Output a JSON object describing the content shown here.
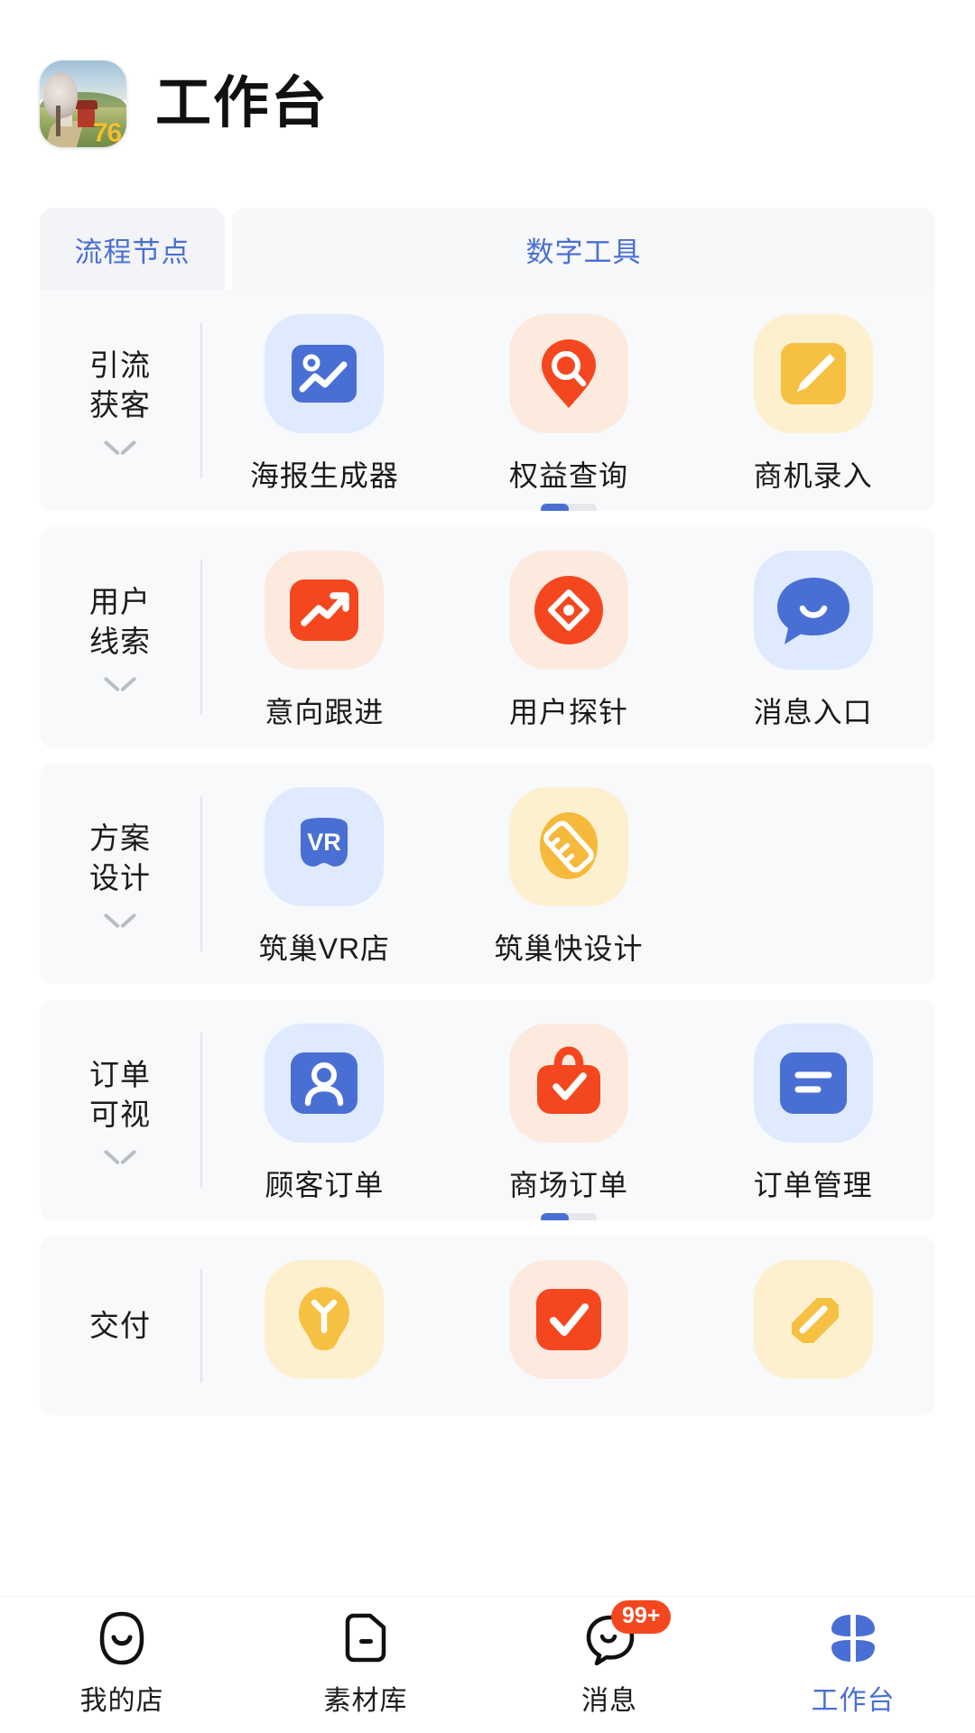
{
  "header": {
    "title": "工作台",
    "app_icon": "farm-landscape-app-icon",
    "icon_badge": "76"
  },
  "tabs": [
    {
      "id": "process-nodes",
      "label": "流程节点",
      "active": true
    },
    {
      "id": "digital-tools",
      "label": "数字工具",
      "active": false
    }
  ],
  "groups": [
    {
      "id": "lead-acquisition",
      "label": "引流\n获客",
      "label_lines": [
        "引流",
        "获客"
      ],
      "has_pager": true,
      "pager_page": 1,
      "pager_total": 2,
      "tiles": [
        {
          "id": "poster-generator",
          "label": "海报生成器",
          "icon": "chart-trend-icon",
          "bg": "bg-blue",
          "fg": "#4a6fd4"
        },
        {
          "id": "benefit-query",
          "label": "权益查询",
          "icon": "search-pin-icon",
          "bg": "bg-peach",
          "fg": "#f5471f"
        },
        {
          "id": "opportunity-entry",
          "label": "商机录入",
          "icon": "pencil-icon",
          "bg": "bg-yellow",
          "fg": "#f6c042"
        }
      ]
    },
    {
      "id": "user-clues",
      "label_lines": [
        "用户",
        "线索"
      ],
      "has_pager": false,
      "tiles": [
        {
          "id": "intent-followup",
          "label": "意向跟进",
          "icon": "trend-arrow-icon",
          "bg": "bg-peach",
          "fg": "#f5471f"
        },
        {
          "id": "user-probe",
          "label": "用户探针",
          "icon": "compass-icon",
          "bg": "bg-peach",
          "fg": "#f5471f"
        },
        {
          "id": "message-entry",
          "label": "消息入口",
          "icon": "chat-bubble-icon",
          "bg": "bg-blue",
          "fg": "#4a6fd4"
        }
      ]
    },
    {
      "id": "plan-design",
      "label_lines": [
        "方案",
        "设计"
      ],
      "has_pager": false,
      "tiles": [
        {
          "id": "nest-vr-store",
          "label": "筑巢VR店",
          "icon": "vr-headset-icon",
          "bg": "bg-blue",
          "fg": "#4a6fd4"
        },
        {
          "id": "nest-quick-design",
          "label": "筑巢快设计",
          "icon": "ruler-icon",
          "bg": "bg-yellow",
          "fg": "#f6b93b"
        },
        {
          "id": "empty-slot-1",
          "label": "",
          "icon": "",
          "bg": "",
          "fg": "",
          "empty": true
        }
      ]
    },
    {
      "id": "order-visibility",
      "label_lines": [
        "订单",
        "可视"
      ],
      "has_pager": true,
      "pager_page": 1,
      "pager_total": 2,
      "tiles": [
        {
          "id": "customer-order",
          "label": "顾客订单",
          "icon": "person-icon",
          "bg": "bg-blue",
          "fg": "#4a6fd4"
        },
        {
          "id": "mall-order",
          "label": "商场订单",
          "icon": "bag-check-icon",
          "bg": "bg-peach",
          "fg": "#f5471f"
        },
        {
          "id": "order-manage",
          "label": "订单管理",
          "icon": "document-list-icon",
          "bg": "bg-blue",
          "fg": "#4a6fd4"
        }
      ]
    },
    {
      "id": "delivery",
      "label_lines": [
        "交付",
        ""
      ],
      "has_pager": false,
      "partial": true,
      "tiles": [
        {
          "id": "delivery-idea",
          "label": "",
          "icon": "bulb-icon",
          "bg": "bg-yellow",
          "fg": "#f6c042"
        },
        {
          "id": "delivery-check",
          "label": "",
          "icon": "check-icon",
          "bg": "bg-peach",
          "fg": "#f5471f"
        },
        {
          "id": "delivery-tool",
          "label": "",
          "icon": "hammer-icon",
          "bg": "bg-yellow",
          "fg": "#f6c042"
        }
      ]
    }
  ],
  "bottom_nav": [
    {
      "id": "my-store",
      "label": "我的店",
      "icon": "store-face-icon",
      "active": false,
      "badge": ""
    },
    {
      "id": "material",
      "label": "素材库",
      "icon": "folder-icon",
      "active": false,
      "badge": ""
    },
    {
      "id": "messages",
      "label": "消息",
      "icon": "chat-ghost-icon",
      "active": false,
      "badge": "99+"
    },
    {
      "id": "workbench",
      "label": "工作台",
      "icon": "grid-petal-icon",
      "active": true,
      "badge": ""
    }
  ],
  "colors": {
    "accent_blue": "#4a6fd4",
    "accent_red": "#f5471f",
    "accent_yellow": "#f6c042",
    "card_bg": "#f8f9fb",
    "text_primary": "#1a1a1a"
  }
}
